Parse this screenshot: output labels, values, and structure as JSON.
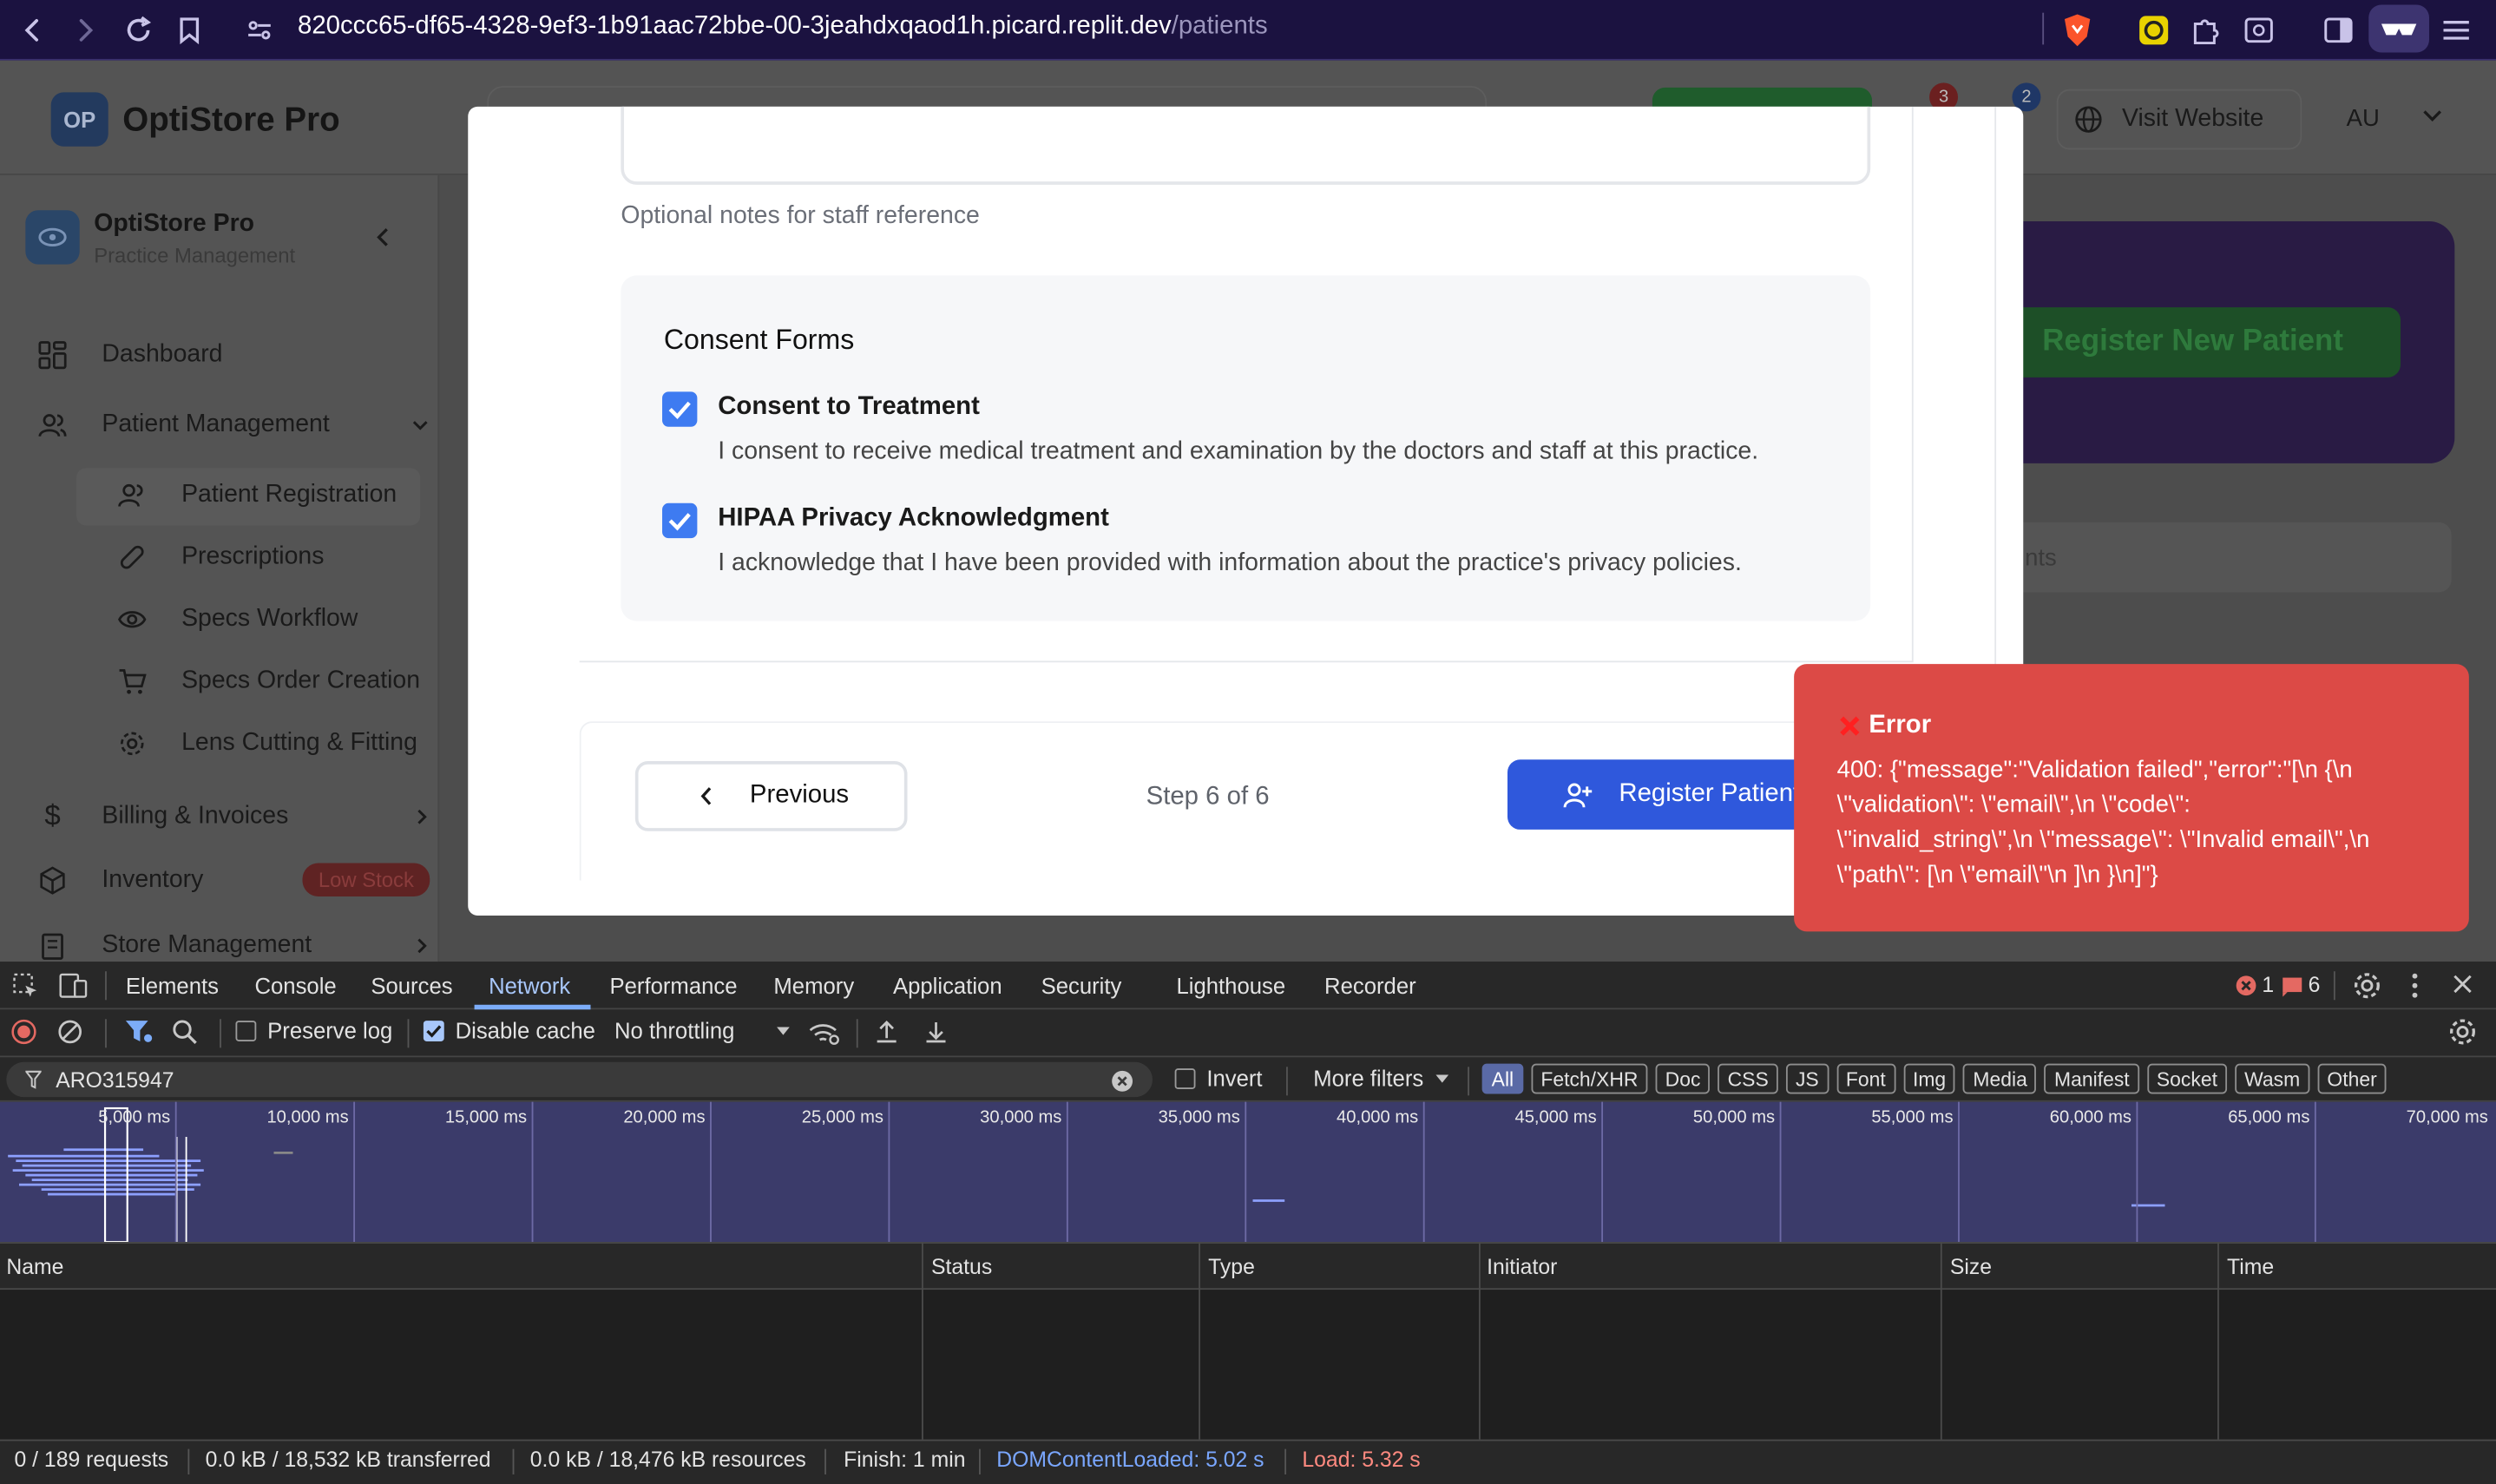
{
  "browser": {
    "url_host": "820ccc65-df65-4328-9ef3-1b91aac72bbe-00-3jeahdxqaod1h.picard.replit.dev",
    "url_path": "/patients",
    "icons": [
      "back-icon",
      "forward-icon",
      "reload-icon",
      "bookmark-icon",
      "site-info-icon",
      "brave-shield-icon",
      "extension-icon",
      "puzzle-icon",
      "search-page-icon",
      "sidebar-icon",
      "reader-mode-icon",
      "menu-icon"
    ]
  },
  "app": {
    "logo_badge": "OP",
    "brand": "OptiStore Pro",
    "header": {
      "notif_count_red": "3",
      "notif_count_blue": "2",
      "visit_website": "Visit Website",
      "user_initials": "AU"
    },
    "sidebar": {
      "brand": "OptiStore Pro",
      "subtitle": "Practice Management",
      "items": [
        {
          "label": "Dashboard"
        },
        {
          "label": "Patient Management"
        },
        {
          "label": "Patient Registration"
        },
        {
          "label": "Prescriptions"
        },
        {
          "label": "Specs Workflow"
        },
        {
          "label": "Specs Order Creation"
        },
        {
          "label": "Lens Cutting & Fitting"
        },
        {
          "label": "Billing & Invoices"
        },
        {
          "label": "Inventory"
        },
        {
          "label": "Store Management"
        }
      ],
      "inventory_badge": "Low Stock"
    },
    "background": {
      "register_new_patient": "Register New Patient",
      "search_fragment": "nts"
    }
  },
  "modal": {
    "notes_helper": "Optional notes for staff reference",
    "consent_title": "Consent Forms",
    "consents": [
      {
        "title": "Consent to Treatment",
        "description": "I consent to receive medical treatment and examination by the doctors and staff at this practice.",
        "checked": true
      },
      {
        "title": "HIPAA Privacy Acknowledgment",
        "description": "I acknowledge that I have been provided with information about the practice's privacy policies.",
        "checked": true
      }
    ],
    "previous_label": "Previous",
    "step_text": "Step 6 of 6",
    "register_label": "Register Patient"
  },
  "toast": {
    "title": "Error",
    "lines": [
      "400: {\"message\":\"Validation failed\",\"error\":\"[\\n {\\n",
      "\\\"validation\\\": \\\"email\\\",\\n \\\"code\\\":",
      "\\\"invalid_string\\\",\\n \\\"message\\\": \\\"Invalid email\\\",\\n",
      "\\\"path\\\": [\\n \\\"email\\\"\\n ]\\n }\\n]\"}"
    ]
  },
  "devtools": {
    "tabs": [
      "Elements",
      "Console",
      "Sources",
      "Network",
      "Performance",
      "Memory",
      "Application",
      "Security",
      "Lighthouse",
      "Recorder"
    ],
    "active_tab": "Network",
    "error_count": "1",
    "issue_count": "6",
    "preserve_log": "Preserve log",
    "disable_cache": "Disable cache",
    "throttling": "No throttling",
    "filter_value": "ARO315947",
    "invert": "Invert",
    "more_filters": "More filters",
    "type_filters": [
      "All",
      "Fetch/XHR",
      "Doc",
      "CSS",
      "JS",
      "Font",
      "Img",
      "Media",
      "Manifest",
      "Socket",
      "Wasm",
      "Other"
    ],
    "timeline_ticks": [
      "5,000 ms",
      "10,000 ms",
      "15,000 ms",
      "20,000 ms",
      "25,000 ms",
      "30,000 ms",
      "35,000 ms",
      "40,000 ms",
      "45,000 ms",
      "50,000 ms",
      "55,000 ms",
      "60,000 ms",
      "65,000 ms",
      "70,000 ms"
    ],
    "columns": [
      "Name",
      "Status",
      "Type",
      "Initiator",
      "Size",
      "Time"
    ],
    "status": {
      "requests": "0 / 189 requests",
      "transferred": "0.0 kB / 18,532 kB transferred",
      "resources": "0.0 kB / 18,476 kB resources",
      "finish": "Finish: 1 min",
      "dom_loaded": "DOMContentLoaded: 5.02 s",
      "load": "Load: 5.32 s"
    },
    "colors": {
      "dom_loaded": "#7aa7ff",
      "load": "#ff8a80",
      "active_tab_underline": "#7cacf8"
    }
  }
}
